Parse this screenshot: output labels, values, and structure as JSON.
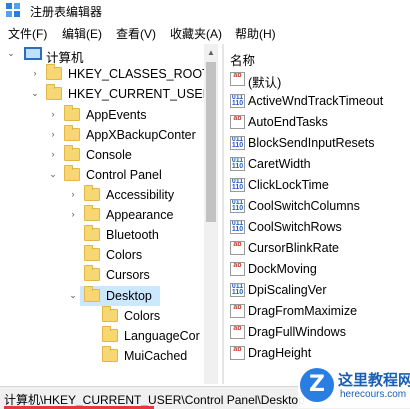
{
  "window": {
    "title": "注册表编辑器"
  },
  "menu": [
    "文件(F)",
    "编辑(E)",
    "查看(V)",
    "收藏夹(A)",
    "帮助(H)"
  ],
  "tree": [
    {
      "label": "计算机",
      "chev": "⌄",
      "icon": "computer-icon"
    },
    {
      "label": "HKEY_CLASSES_ROOT",
      "chev": "›",
      "icon": "folder-icon"
    },
    {
      "label": "HKEY_CURRENT_USER",
      "chev": "⌄",
      "icon": "folder-icon"
    },
    {
      "label": "AppEvents",
      "chev": "›",
      "icon": "folder-icon"
    },
    {
      "label": "AppXBackupConter",
      "chev": "›",
      "icon": "folder-icon"
    },
    {
      "label": "Console",
      "chev": "›",
      "icon": "folder-icon"
    },
    {
      "label": "Control Panel",
      "chev": "⌄",
      "icon": "folder-icon"
    },
    {
      "label": "Accessibility",
      "chev": "›",
      "icon": "folder-icon"
    },
    {
      "label": "Appearance",
      "chev": "›",
      "icon": "folder-icon"
    },
    {
      "label": "Bluetooth",
      "chev": "",
      "icon": "folder-icon"
    },
    {
      "label": "Colors",
      "chev": "",
      "icon": "folder-icon"
    },
    {
      "label": "Cursors",
      "chev": "",
      "icon": "folder-icon"
    },
    {
      "label": "Desktop",
      "chev": "⌄",
      "icon": "folder-icon",
      "selected": true
    },
    {
      "label": "Colors",
      "chev": "",
      "icon": "folder-icon"
    },
    {
      "label": "LanguageCor",
      "chev": "",
      "icon": "folder-icon"
    },
    {
      "label": "MuiCached",
      "chev": "",
      "icon": "folder-icon"
    }
  ],
  "values_header": "名称",
  "values": [
    {
      "name": "(默认)",
      "type": "sz"
    },
    {
      "name": "ActiveWndTrackTimeout",
      "type": "dword"
    },
    {
      "name": "AutoEndTasks",
      "type": "sz"
    },
    {
      "name": "BlockSendInputResets",
      "type": "dword"
    },
    {
      "name": "CaretWidth",
      "type": "dword"
    },
    {
      "name": "ClickLockTime",
      "type": "dword"
    },
    {
      "name": "CoolSwitchColumns",
      "type": "dword"
    },
    {
      "name": "CoolSwitchRows",
      "type": "dword"
    },
    {
      "name": "CursorBlinkRate",
      "type": "sz"
    },
    {
      "name": "DockMoving",
      "type": "sz"
    },
    {
      "name": "DpiScalingVer",
      "type": "dword"
    },
    {
      "name": "DragFromMaximize",
      "type": "sz"
    },
    {
      "name": "DragFullWindows",
      "type": "sz"
    },
    {
      "name": "DragHeight",
      "type": "sz"
    }
  ],
  "status": {
    "path": "计算机\\HKEY_CURRENT_USER\\Control Panel\\Desktop"
  },
  "watermark": {
    "badge": "Z",
    "title": "这里教程网",
    "url": "herecours.com"
  },
  "colors": {
    "selection": "#cce8ff",
    "folder": "#f7d774",
    "accent": "#e23a3a"
  }
}
